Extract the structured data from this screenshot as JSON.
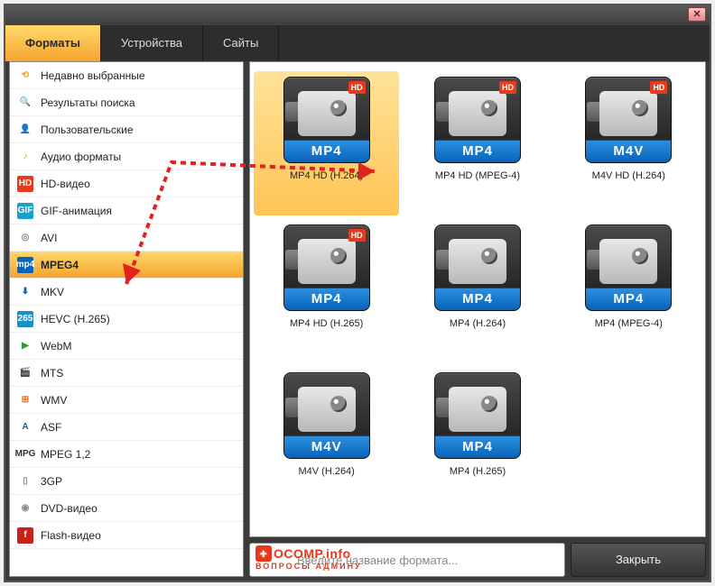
{
  "tabs": {
    "formats": "Форматы",
    "devices": "Устройства",
    "sites": "Сайты"
  },
  "close_x": "✕",
  "sidebar": {
    "items": [
      {
        "label": "Недавно выбранные",
        "icon": "⟲",
        "ibg": "#fff",
        "ifg": "#f59a20"
      },
      {
        "label": "Результаты поиска",
        "icon": "🔍",
        "ibg": "#fff",
        "ifg": "#666"
      },
      {
        "label": "Пользовательские",
        "icon": "👤",
        "ibg": "#fff",
        "ifg": "#666"
      },
      {
        "label": "Аудио форматы",
        "icon": "♪",
        "ibg": "#fff",
        "ifg": "#f59a20"
      },
      {
        "label": "HD-видео",
        "icon": "HD",
        "ibg": "#e63a1c",
        "ifg": "#fff"
      },
      {
        "label": "GIF-анимация",
        "icon": "GIF",
        "ibg": "#1aa0cc",
        "ifg": "#fff"
      },
      {
        "label": "AVI",
        "icon": "◎",
        "ibg": "#fff",
        "ifg": "#888"
      },
      {
        "label": "MPEG4",
        "icon": "mp4",
        "ibg": "#0863b8",
        "ifg": "#fff",
        "selected": true
      },
      {
        "label": "MKV",
        "icon": "⬇",
        "ibg": "#fff",
        "ifg": "#0863b8"
      },
      {
        "label": "HEVC (H.265)",
        "icon": "265",
        "ibg": "#1a90c8",
        "ifg": "#fff"
      },
      {
        "label": "WebM",
        "icon": "▶",
        "ibg": "#fff",
        "ifg": "#2aa02a"
      },
      {
        "label": "MTS",
        "icon": "🎬",
        "ibg": "#fff",
        "ifg": "#555"
      },
      {
        "label": "WMV",
        "icon": "⊞",
        "ibg": "#fff",
        "ifg": "#e06a1a"
      },
      {
        "label": "ASF",
        "icon": "A",
        "ibg": "#fff",
        "ifg": "#0863b8"
      },
      {
        "label": "MPEG 1,2",
        "icon": "MPG",
        "ibg": "#fff",
        "ifg": "#333"
      },
      {
        "label": "3GP",
        "icon": "▯",
        "ibg": "#fff",
        "ifg": "#888"
      },
      {
        "label": "DVD-видео",
        "icon": "◉",
        "ibg": "#fff",
        "ifg": "#888"
      },
      {
        "label": "Flash-видео",
        "icon": "f",
        "ibg": "#c8201a",
        "ifg": "#fff"
      }
    ]
  },
  "formats": [
    {
      "codec": "MP4",
      "label": "MP4 HD (H.264)",
      "hd": true,
      "selected": true
    },
    {
      "codec": "MP4",
      "label": "MP4 HD (MPEG-4)",
      "hd": true
    },
    {
      "codec": "M4V",
      "label": "M4V HD (H.264)",
      "hd": true
    },
    {
      "codec": "MP4",
      "label": "MP4 HD (H.265)",
      "hd": true
    },
    {
      "codec": "MP4",
      "label": "MP4 (H.264)",
      "hd": false
    },
    {
      "codec": "MP4",
      "label": "MP4 (MPEG-4)",
      "hd": false
    },
    {
      "codec": "M4V",
      "label": "M4V (H.264)",
      "hd": false
    },
    {
      "codec": "MP4",
      "label": "MP4 (H.265)",
      "hd": false
    }
  ],
  "hd_badge": "HD",
  "footer": {
    "search_placeholder": "Введите название формата...",
    "close": "Закрыть"
  },
  "watermark": {
    "brand": "OCOMP.info",
    "sub": "ВОПРОСЫ АДМИНУ",
    "plus": "+"
  }
}
